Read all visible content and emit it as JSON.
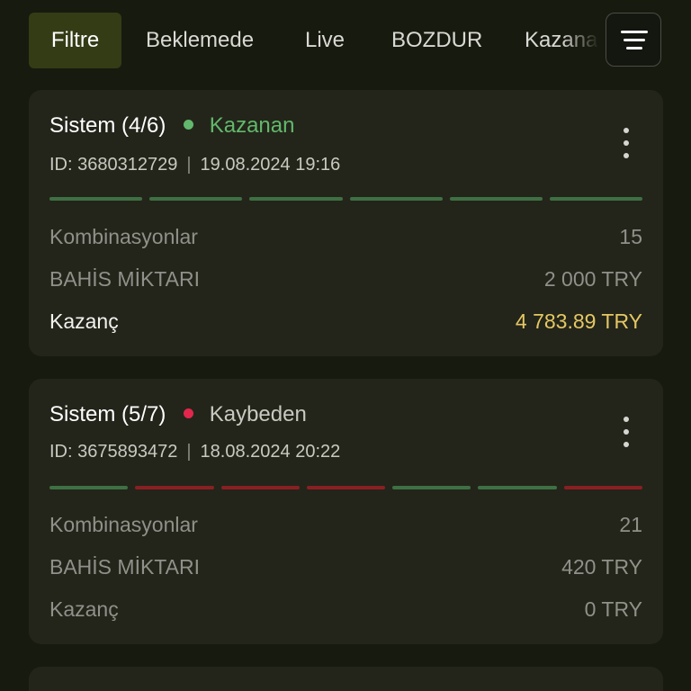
{
  "tabs": [
    {
      "label": "Filtre",
      "active": true
    },
    {
      "label": "Beklemede",
      "active": false
    },
    {
      "label": "Live",
      "active": false
    },
    {
      "label": "BOZDUR",
      "active": false
    },
    {
      "label": "Kazanan",
      "active": false
    }
  ],
  "menu_icon": "hamburger-menu-icon",
  "colors": {
    "win": "#62b86c",
    "lose": "#e3264c",
    "segment_win": "#3e7044",
    "segment_lose": "#8a1f22",
    "amount_win": "#e5c764"
  },
  "bets": [
    {
      "title": "Sistem (4/6)",
      "status": "Kazanan",
      "status_type": "win",
      "id_label": "ID: 3680312729",
      "datetime": "19.08.2024 19:16",
      "segments": [
        "win",
        "win",
        "win",
        "win",
        "win",
        "win"
      ],
      "rows": [
        {
          "label": "Kombinasyonlar",
          "value": "15"
        },
        {
          "label": "BAHİS MİKTARI",
          "value": "2 000 TRY"
        },
        {
          "label": "Kazanç",
          "value": "4 783.89 TRY"
        }
      ]
    },
    {
      "title": "Sistem (5/7)",
      "status": "Kaybeden",
      "status_type": "lose",
      "id_label": "ID: 3675893472",
      "datetime": "18.08.2024 20:22",
      "segments": [
        "win",
        "lose",
        "lose",
        "lose",
        "win",
        "win",
        "lose"
      ],
      "rows": [
        {
          "label": "Kombinasyonlar",
          "value": "21"
        },
        {
          "label": "BAHİS MİKTARI",
          "value": "420 TRY"
        },
        {
          "label": "Kazanç",
          "value": "0 TRY"
        }
      ]
    }
  ]
}
